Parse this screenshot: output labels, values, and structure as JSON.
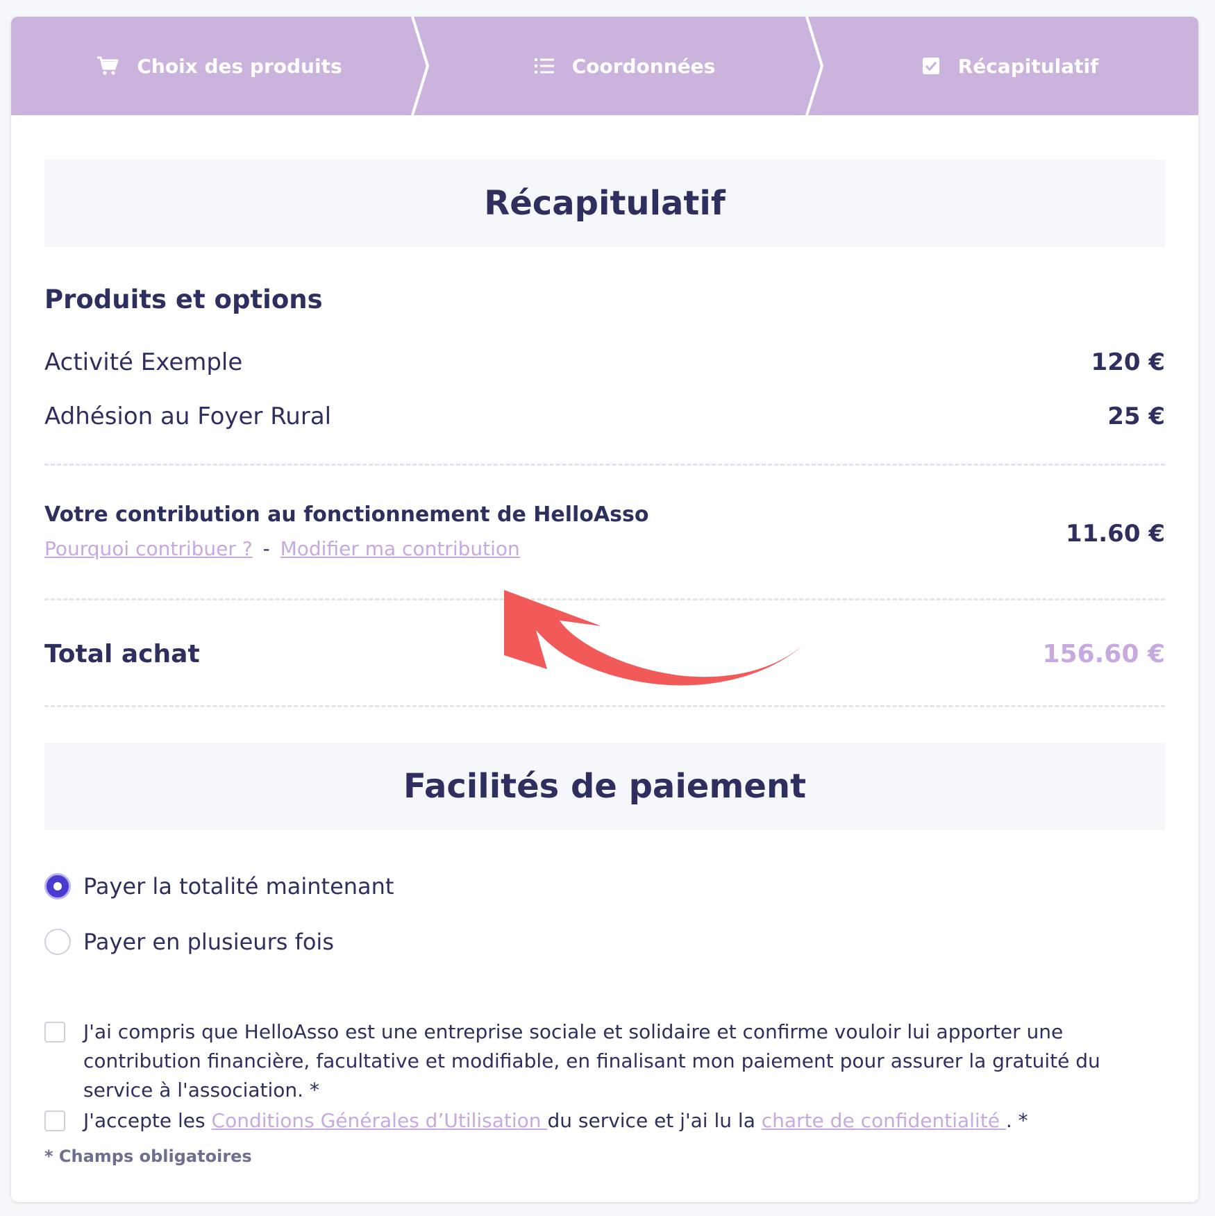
{
  "steps": [
    {
      "label": "Choix des produits",
      "icon": "cart-icon"
    },
    {
      "label": "Coordonnées",
      "icon": "list-icon"
    },
    {
      "label": "Récapitulatif",
      "icon": "checked-box-icon"
    }
  ],
  "recap": {
    "title": "Récapitulatif",
    "products_heading": "Produits et options",
    "items": [
      {
        "name": "Activité Exemple",
        "price": "120 €"
      },
      {
        "name": "Adhésion au Foyer Rural",
        "price": "25 €"
      }
    ],
    "contribution": {
      "title": "Votre contribution au fonctionnement de HelloAsso",
      "why_link": "Pourquoi contribuer ?",
      "separator": "-",
      "modify_link": "Modifier ma contribution",
      "price": "11.60 €"
    },
    "total": {
      "label": "Total achat",
      "price": "156.60 €"
    }
  },
  "payment": {
    "title": "Facilités de paiement",
    "options": [
      {
        "label": "Payer la totalité maintenant",
        "selected": true
      },
      {
        "label": "Payer en plusieurs fois",
        "selected": false
      }
    ]
  },
  "consents": {
    "first": "J'ai compris que HelloAsso est une entreprise sociale et solidaire et confirme vouloir lui apporter une contribution financière, facultative et modifiable, en finalisant mon paiement pour assurer la gratuité du service à l'association. *",
    "second_prefix": "J'accepte les ",
    "cgu_link": "Conditions Générales d’Utilisation ",
    "second_middle": "du service et j'ai lu la ",
    "privacy_link": "charte de confidentialité ",
    "second_suffix": ". *"
  },
  "required_note": "* Champs obligatoires",
  "colors": {
    "accent": "#cab4dd",
    "link": "#c6a9df",
    "text": "#2e2f5e",
    "radio_selected": "#4a3bd0",
    "annotation_arrow": "#f25a5a"
  }
}
